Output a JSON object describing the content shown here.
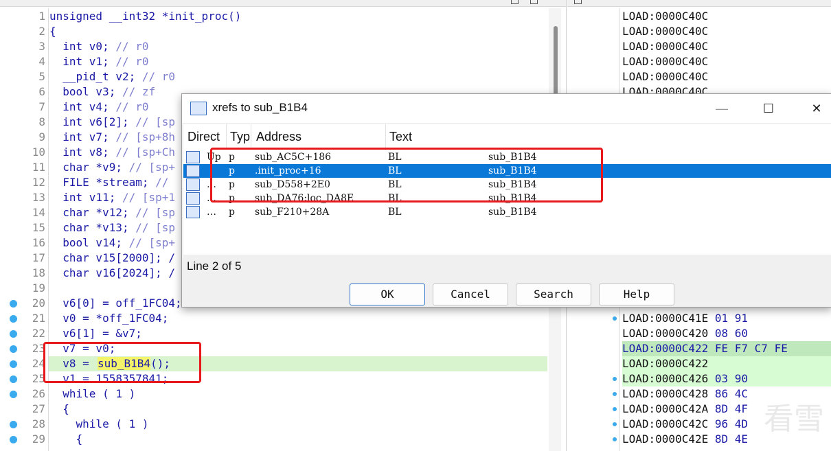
{
  "code": {
    "lines": [
      {
        "n": "1",
        "t": "unsigned __int32 *init_proc()"
      },
      {
        "n": "2",
        "t": "{"
      },
      {
        "n": "3",
        "t": "  int v0; // r0"
      },
      {
        "n": "4",
        "t": "  int v1; // r0"
      },
      {
        "n": "5",
        "t": "  __pid_t v2; // r0"
      },
      {
        "n": "6",
        "t": "  bool v3; // zf"
      },
      {
        "n": "7",
        "t": "  int v4; // r0"
      },
      {
        "n": "8",
        "t": "  int v6[2]; // [sp"
      },
      {
        "n": "9",
        "t": "  int v7; // [sp+8h"
      },
      {
        "n": "10",
        "t": "  int v8; // [sp+Ch"
      },
      {
        "n": "11",
        "t": "  char *v9; // [sp+"
      },
      {
        "n": "12",
        "t": "  FILE *stream; //"
      },
      {
        "n": "13",
        "t": "  int v11; // [sp+1"
      },
      {
        "n": "14",
        "t": "  char *v12; // [sp"
      },
      {
        "n": "15",
        "t": "  char *v13; // [sp"
      },
      {
        "n": "16",
        "t": "  bool v14; // [sp+"
      },
      {
        "n": "17",
        "t": "  char v15[2000]; /"
      },
      {
        "n": "18",
        "t": "  char v16[2024]; /"
      },
      {
        "n": "19",
        "t": ""
      },
      {
        "n": "20",
        "t": "  v6[0] = off_1FC04;"
      },
      {
        "n": "21",
        "t": "  v0 = *off_1FC04;"
      },
      {
        "n": "22",
        "t": "  v6[1] = &v7;"
      },
      {
        "n": "23",
        "t": "  v7 = v0;"
      },
      {
        "n": "24",
        "t": "  v8 = "
      },
      {
        "n": "25",
        "t": "  v1 = 1558357841;"
      },
      {
        "n": "26",
        "t": "  while ( 1 )"
      },
      {
        "n": "27",
        "t": "  {"
      },
      {
        "n": "28",
        "t": "    while ( 1 )"
      },
      {
        "n": "29",
        "t": "    {"
      }
    ],
    "hl_func": "sub_B1B4",
    "hl_tail": "();"
  },
  "asm": {
    "lines": [
      {
        "a": "LOAD:0000C40C",
        "h": ""
      },
      {
        "a": "LOAD:0000C40C",
        "h": ""
      },
      {
        "a": "LOAD:0000C40C",
        "h": ""
      },
      {
        "a": "LOAD:0000C40C",
        "h": ""
      },
      {
        "a": "LOAD:0000C40C",
        "h": ""
      },
      {
        "a": "LOAD:0000C40C",
        "h": ""
      }
    ],
    "lower": [
      {
        "a": "LOAD:0000C41E",
        "h": " 01 91"
      },
      {
        "a": "LOAD:0000C420",
        "h": " 08 60"
      },
      {
        "a": "LOAD:0000C422",
        "h": " FE F7 C7 FE"
      },
      {
        "a": "LOAD:0000C422",
        "h": ""
      },
      {
        "a": "LOAD:0000C426",
        "h": " 03 90"
      },
      {
        "a": "LOAD:0000C428",
        "h": " 86 4C"
      },
      {
        "a": "LOAD:0000C42A",
        "h": " 8D 4F"
      },
      {
        "a": "LOAD:0000C42C",
        "h": " 96 4D"
      },
      {
        "a": "LOAD:0000C42E",
        "h": " 8D 4E"
      }
    ]
  },
  "dialog": {
    "title": "xrefs to sub_B1B4",
    "minimize": "—",
    "maximize": "☐",
    "close": "✕",
    "columns": [
      "Direct",
      "Typ",
      "Address",
      "Text"
    ],
    "rows": [
      {
        "dir": "Up",
        "typ": "p",
        "addr": "sub_AC5C+186",
        "op": "BL",
        "target": "sub_B1B4"
      },
      {
        "dir": "",
        "typ": "p",
        "addr": ".init_proc+16",
        "op": "BL",
        "target": "sub_B1B4"
      },
      {
        "dir": "…",
        "typ": "p",
        "addr": "sub_D558+2E0",
        "op": "BL",
        "target": "sub_B1B4"
      },
      {
        "dir": "…",
        "typ": "p",
        "addr": "sub_DA76:loc_DA8E",
        "op": "BL",
        "target": "sub_B1B4"
      },
      {
        "dir": "…",
        "typ": "p",
        "addr": "sub_F210+28A",
        "op": "BL",
        "target": "sub_B1B4"
      }
    ],
    "status": "Line 2 of 5",
    "buttons": {
      "ok": "OK",
      "cancel": "Cancel",
      "search": "Search",
      "help": "Help"
    }
  },
  "watermark": "看雪"
}
